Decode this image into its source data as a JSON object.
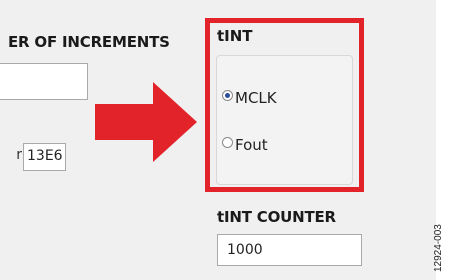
{
  "number_of_increments": {
    "label": "ER OF INCREMENTS",
    "value": ""
  },
  "partial_field": {
    "label_fragment": "r",
    "value": "13E6"
  },
  "tint_group": {
    "title": "tINT",
    "options": [
      {
        "label": "MCLK",
        "selected": true
      },
      {
        "label": "Fout",
        "selected": false
      }
    ]
  },
  "tint_counter": {
    "label": "tINT COUNTER",
    "value": "1000"
  },
  "annotation": {
    "arrow_color": "#e2232a",
    "highlight_color": "#e2232a"
  },
  "figure_code": "12924-003"
}
